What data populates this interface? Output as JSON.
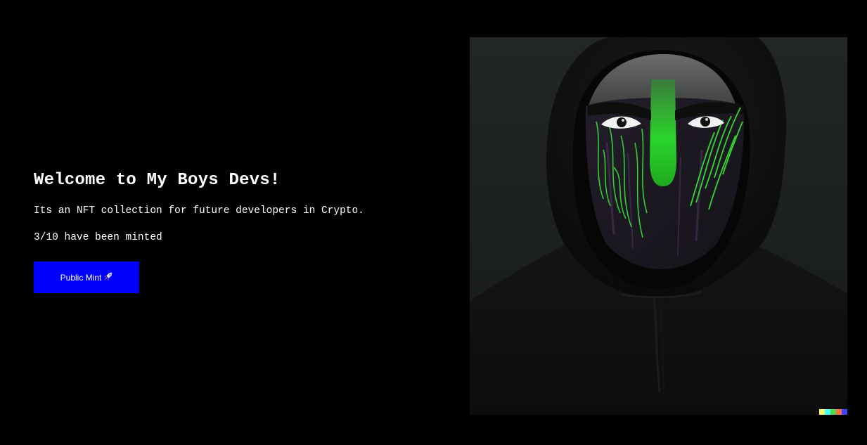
{
  "hero": {
    "title": "Welcome to My Boys Devs!",
    "description": "Its an NFT collection for future developers in Crypto.",
    "minted_count": "3/10",
    "minted_suffix": " have been minted",
    "mint_button_label": "Public Mint",
    "mint_button_icon": "rocket-icon"
  },
  "nft_image": {
    "subject": "hooded-masked-figure",
    "colors": {
      "background": "#1d211f",
      "hood": "#0c0d0c",
      "mask_stripe": "#2bd52b",
      "mask": "#1e1a22",
      "button": "#0000ff"
    },
    "watermark_colors": [
      "#ffff66",
      "#42ffff",
      "#51da4c",
      "#ff6e3c",
      "#3c46ff"
    ]
  },
  "page": {
    "background": "#000000",
    "text_color": "#ffffff"
  }
}
